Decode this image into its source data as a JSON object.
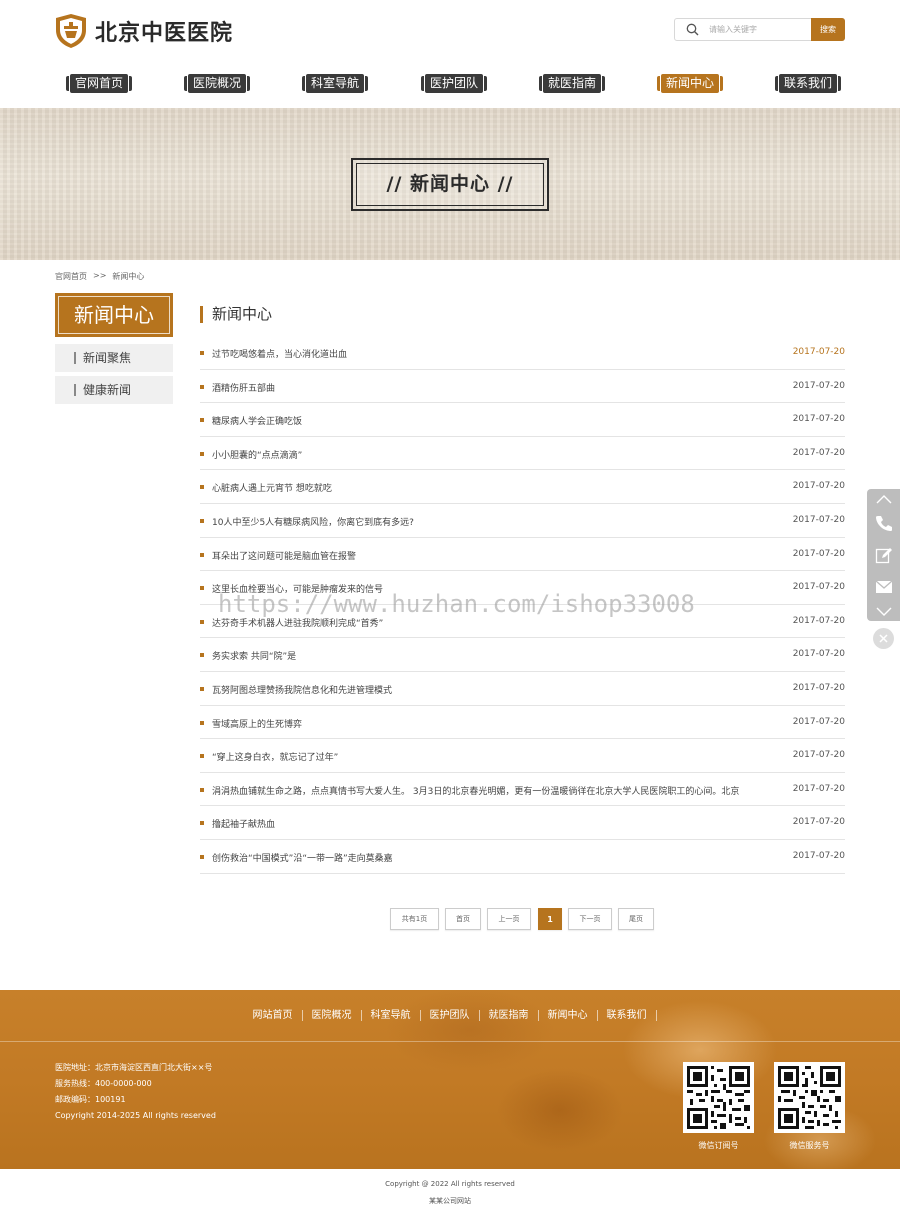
{
  "site": {
    "logo_text": "北京中医医院"
  },
  "search": {
    "placeholder": "请输入关键字",
    "button_label": "搜索"
  },
  "nav": {
    "items": [
      {
        "label": "官网首页",
        "active": false
      },
      {
        "label": "医院概况",
        "active": false
      },
      {
        "label": "科室导航",
        "active": false
      },
      {
        "label": "医护团队",
        "active": false
      },
      {
        "label": "就医指南",
        "active": false
      },
      {
        "label": "新闻中心",
        "active": true
      },
      {
        "label": "联系我们",
        "active": false
      }
    ]
  },
  "banner": {
    "title": "// 新闻中心 //"
  },
  "breadcrumb": {
    "home": "官网首页",
    "separator": ">>",
    "current": "新闻中心"
  },
  "sidebar": {
    "title": "新闻中心",
    "items": [
      {
        "label": "新闻聚焦"
      },
      {
        "label": "健康新闻"
      }
    ]
  },
  "main": {
    "title": "新闻中心",
    "news": [
      {
        "title": "过节吃喝悠着点，当心消化道出血",
        "date": "2017-07-20"
      },
      {
        "title": "酒精伤肝五部曲",
        "date": "2017-07-20"
      },
      {
        "title": "糖尿病人学会正确吃饭",
        "date": "2017-07-20"
      },
      {
        "title": "小小胆囊的“点点滴滴”",
        "date": "2017-07-20"
      },
      {
        "title": "心脏病人遇上元宵节 想吃就吃",
        "date": "2017-07-20"
      },
      {
        "title": "10人中至少5人有糖尿病风险，你离它到底有多远?",
        "date": "2017-07-20"
      },
      {
        "title": "耳朵出了这问题可能是脑血管在报警",
        "date": "2017-07-20"
      },
      {
        "title": "这里长血栓要当心，可能是肿瘤发来的信号",
        "date": "2017-07-20"
      },
      {
        "title": "达芬奇手术机器人进驻我院顺利完成“首秀”",
        "date": "2017-07-20"
      },
      {
        "title": "务实求索 共同“院”是",
        "date": "2017-07-20"
      },
      {
        "title": "瓦努阿图总理赞扬我院信息化和先进管理模式",
        "date": "2017-07-20"
      },
      {
        "title": "雪域高原上的生死博弈",
        "date": "2017-07-20"
      },
      {
        "title": "“穿上这身白衣，就忘记了过年”",
        "date": "2017-07-20"
      },
      {
        "title": "涓涓热血铺就生命之路，点点真情书写大爱人生。 3月3日的北京春光明媚，更有一份温暖徜徉在北京大学人民医院职工的心间。北京",
        "date": "2017-07-20"
      },
      {
        "title": "撸起袖子献热血",
        "date": "2017-07-20"
      },
      {
        "title": "创伤救治“中国模式”沿“一带一路”走向莫桑嘉",
        "date": "2017-07-20"
      }
    ]
  },
  "pagination": {
    "total": "共有1页",
    "first": "首页",
    "prev": "上一页",
    "current": "1",
    "next": "下一页",
    "last": "尾页"
  },
  "watermark": "https://www.huzhan.com/ishop33008",
  "footer": {
    "nav": [
      "网站首页",
      "医院概况",
      "科室导航",
      "医护团队",
      "就医指南",
      "新闻中心",
      "联系我们"
    ],
    "address": "医院地址：北京市海淀区西直门北大街××号",
    "hotline": "服务热线：400-0000-000",
    "postcode": "邮政编码：100191",
    "copyright": "Copyright 2014-2025    All rights reserved",
    "qr_codes": [
      {
        "caption": "微信订阅号"
      },
      {
        "caption": "微信服务号"
      }
    ]
  },
  "bottom": {
    "copyright": "Copyright @ 2022   All rights reserved",
    "company": "某某公司网站"
  },
  "colors": {
    "accent": "#b6741e",
    "nav_dark": "#3a3a3a",
    "footer_bg": "#c27a25"
  }
}
